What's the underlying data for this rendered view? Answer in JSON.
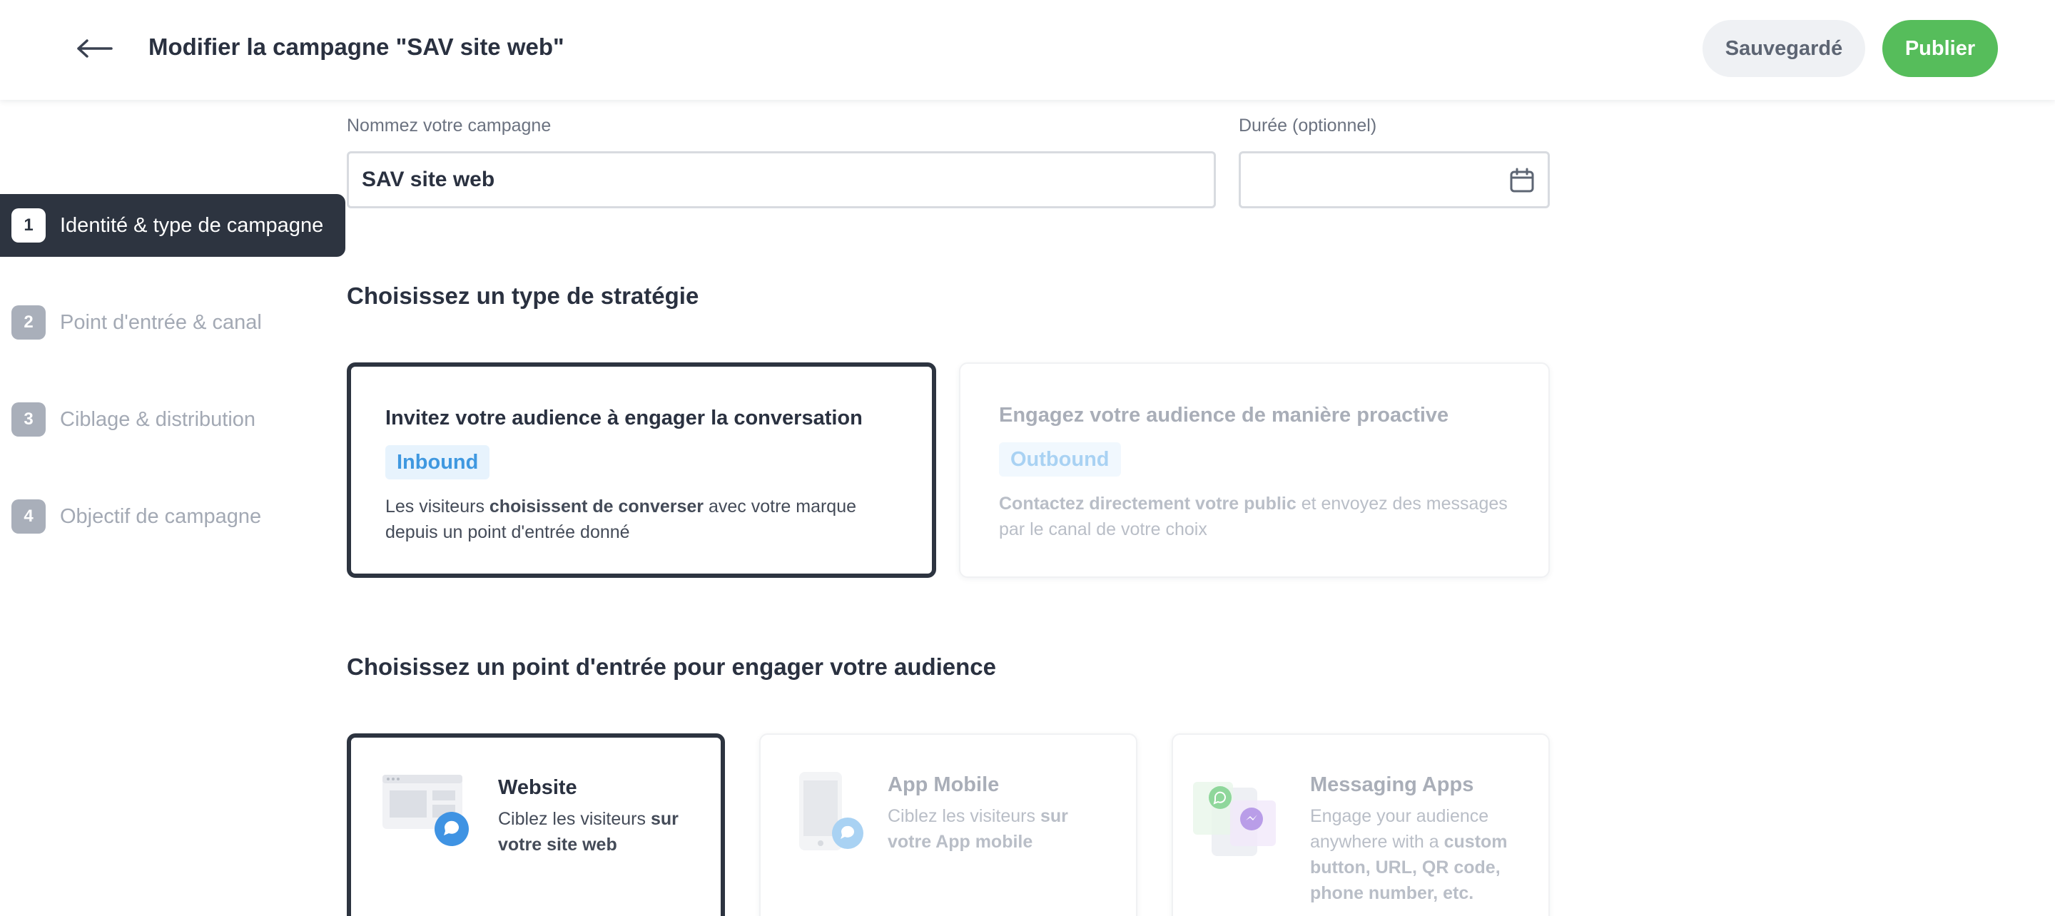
{
  "header": {
    "title": "Modifier la campagne \"SAV site web\"",
    "saved_label": "Sauvegardé",
    "publish_label": "Publier",
    "publish_color": "#56bd5b"
  },
  "steps": [
    {
      "num": "1",
      "label": "Identité & type de campagne",
      "active": true
    },
    {
      "num": "2",
      "label": "Point d'entrée & canal",
      "active": false
    },
    {
      "num": "3",
      "label": "Ciblage & distribution",
      "active": false
    },
    {
      "num": "4",
      "label": "Objectif de campagne",
      "active": false
    }
  ],
  "form": {
    "name_label": "Nommez votre campagne",
    "name_value": "SAV site web",
    "duration_label": "Durée (optionnel)",
    "duration_value": ""
  },
  "strategy": {
    "title": "Choisissez un type de stratégie",
    "cards": [
      {
        "title": "Invitez votre audience à engager la conversation",
        "badge": "Inbound",
        "desc_pre": "Les visiteurs ",
        "desc_bold": "choisissent de converser",
        "desc_post": " avec votre marque",
        "desc_line2": "depuis un point d'entrée donné",
        "selected": true
      },
      {
        "title": "Engagez votre audience de manière proactive",
        "badge": "Outbound",
        "desc_bold": "Contactez directement votre public",
        "desc_post": " et envoyez des messages",
        "desc_line2": "par le canal de votre choix",
        "selected": false
      }
    ]
  },
  "entry": {
    "title": "Choisissez un point d'entrée pour engager votre audience",
    "cards": [
      {
        "title": "Website",
        "desc_pre": "Ciblez les visiteurs ",
        "desc_bold": "sur",
        "desc_line2": "votre site web",
        "selected": true
      },
      {
        "title": "App Mobile",
        "desc_pre": "Ciblez les visiteurs ",
        "desc_bold": "sur",
        "desc_line2": "votre App mobile",
        "selected": false
      },
      {
        "title": "Messaging Apps",
        "desc_l1": "Engage your audience",
        "desc_l2_pre": "anywhere with a ",
        "desc_l2_bold": "custom",
        "desc_l3": "button, URL, QR code,",
        "desc_l4": "phone number, etc.",
        "selected": false
      }
    ]
  },
  "icons": {
    "back": "arrow-left-icon",
    "calendar": "calendar-icon",
    "chat": "chat-bubble-icon",
    "whatsapp": "whatsapp-icon",
    "messenger": "messenger-icon"
  }
}
